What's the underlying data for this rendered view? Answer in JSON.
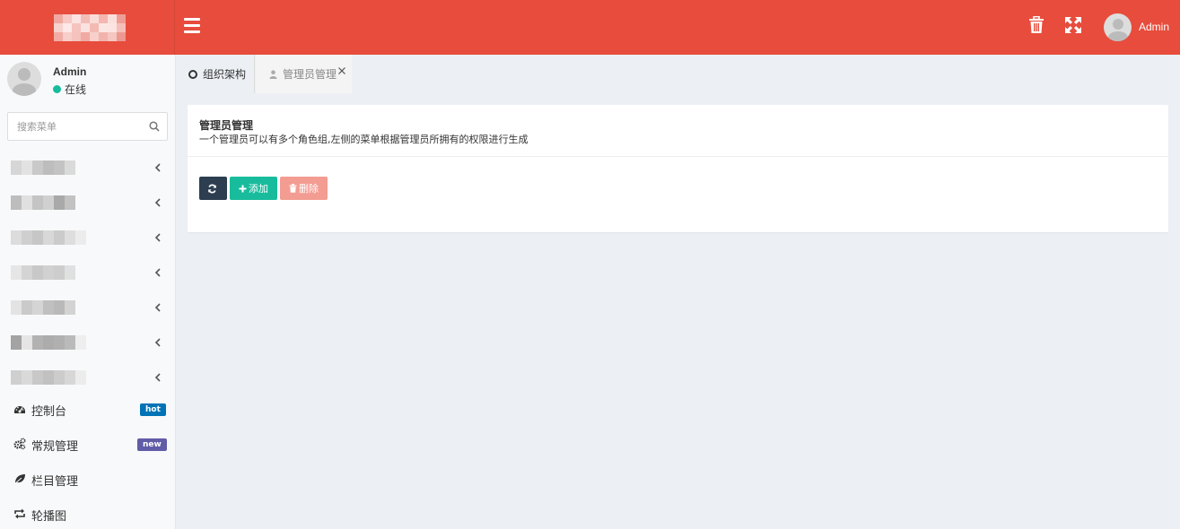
{
  "header": {
    "colors": {
      "bg": "#e74c3c"
    },
    "menu_toggle_icon": "bars-icon",
    "trash_icon": "trash-icon",
    "fullscreen_icon": "expand-icon",
    "user_name": "Admin"
  },
  "sidebar": {
    "user": {
      "name": "Admin",
      "status": "在线",
      "status_color": "#18bc9c"
    },
    "search": {
      "placeholder": "搜索菜单"
    },
    "items": [
      {
        "label": "控制台",
        "icon": "dashboard-icon",
        "badge": "hot",
        "badge_color": "#0073b7"
      },
      {
        "label": "常规管理",
        "icon": "cogs-icon",
        "badge": "new",
        "badge_color": "#605ca8"
      },
      {
        "label": "栏目管理",
        "icon": "leaf-icon"
      },
      {
        "label": "轮播图",
        "icon": "retweet-icon"
      }
    ]
  },
  "tabs": [
    {
      "label": "组织架构",
      "icon": "circle-o-icon"
    },
    {
      "label": "管理员管理",
      "icon": "user-icon"
    }
  ],
  "panel": {
    "title": "管理员管理",
    "description": "一个管理员可以有多个角色组,左侧的菜单根据管理员所拥有的权限进行生成",
    "buttons": {
      "add": "添加",
      "delete": "删除"
    }
  }
}
